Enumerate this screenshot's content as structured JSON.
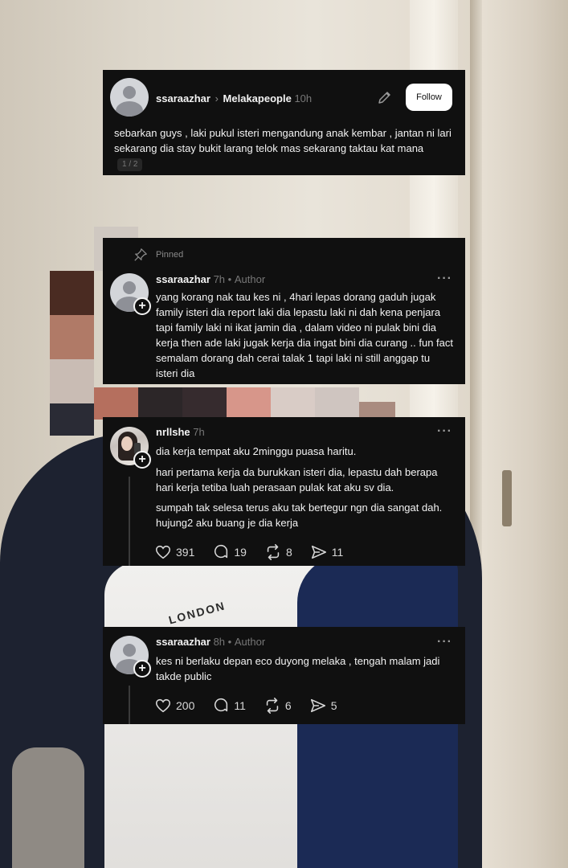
{
  "post": {
    "username": "ssaraazhar",
    "community": "Melakapeople",
    "time": "10h",
    "follow_label": "Follow",
    "text": "sebarkan guys , laki pukul isteri mengandung anak kembar , jantan ni lari sekarang dia stay bukit larang telok mas sekarang taktau kat mana",
    "pager": "1 / 2"
  },
  "pinned_reply": {
    "pinned_label": "Pinned",
    "username": "ssaraazhar",
    "time": "7h",
    "role": "Author",
    "text": "yang korang nak tau kes ni , 4hari lepas dorang gaduh jugak family isteri dia report laki dia lepastu laki ni dah kena penjara tapi family laki ni ikat jamin dia , dalam video ni pulak bini dia kerja then ade laki jugak kerja dia ingat bini dia curang .. fun fact semalam dorang dah cerai talak 1 tapi laki ni still anggap tu isteri dia"
  },
  "reply_nrllshe": {
    "username": "nrllshe",
    "time": "7h",
    "paragraphs": [
      "dia kerja tempat aku 2minggu puasa haritu.",
      "hari pertama kerja da burukkan isteri dia, lepastu dah berapa hari kerja tetiba luah perasaan pulak kat aku sv dia.",
      "sumpah tak selesa terus aku tak bertegur ngn dia sangat dah. hujung2 aku buang je dia kerja"
    ],
    "likes": "391",
    "comments": "19",
    "reposts": "8",
    "shares": "11"
  },
  "reply_author": {
    "username": "ssaraazhar",
    "time": "8h",
    "role": "Author",
    "text": "kes ni berlaku depan eco duyong melaka , tengah malam jadi takde public",
    "likes": "200",
    "comments": "11",
    "reposts": "6",
    "shares": "5"
  },
  "background": {
    "shirt_print": "LONDON"
  },
  "colors": {
    "card_bg": "#101010",
    "text": "#f3f3f3",
    "muted": "#777777",
    "follow_bg": "#ffffff"
  }
}
